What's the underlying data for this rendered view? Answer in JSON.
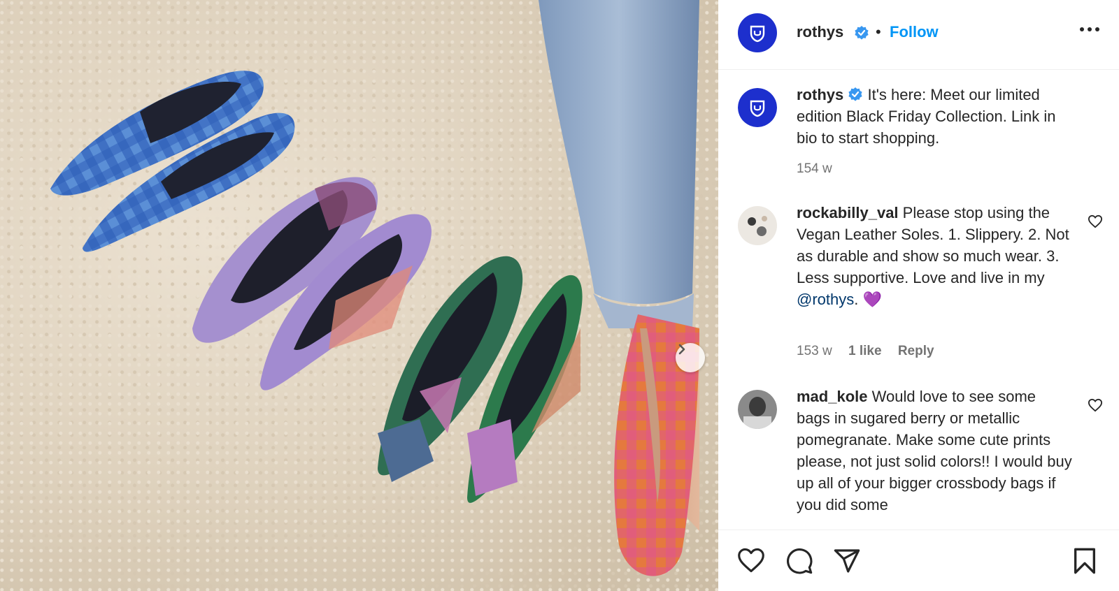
{
  "post": {
    "username": "rothys",
    "verified": true,
    "separator": "•",
    "follow_label": "Follow",
    "more_icon": "more-horizontal-icon",
    "brand_color": "#1d2fcd",
    "accent_color": "#0095f6"
  },
  "caption": {
    "username": "rothys",
    "text": "It's here: Meet our limited edition Black Friday Collection. Link in bio to start shopping.",
    "time": "154 w"
  },
  "comments": [
    {
      "username": "rockabilly_val",
      "text": "Please stop using the Vegan Leather Soles. 1. Slippery. 2. Not as durable and show so much wear. 3. Less supportive. Love and live in my",
      "mention": "@rothys",
      "after_mention": ".",
      "emoji": "💜",
      "time": "153 w",
      "likes": "1 like",
      "reply_label": "Reply"
    },
    {
      "username": "mad_kole",
      "text": "Would love to see some bags in sugared berry or metallic pomegranate. Make some cute prints please, not just solid colors!! I would buy up all of your bigger crossbody bags if you did some"
    }
  ],
  "actions": [
    "heart-icon",
    "comment-icon",
    "share-icon",
    "bookmark-icon"
  ]
}
